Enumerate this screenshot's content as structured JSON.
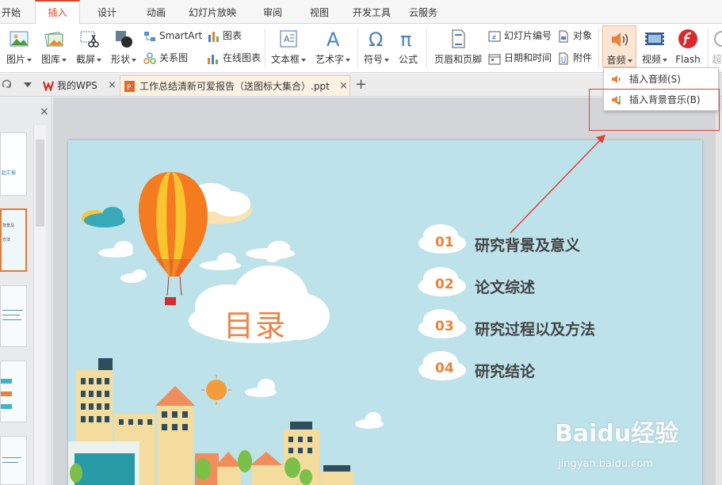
{
  "menu": {
    "tabs": [
      "开始",
      "插入",
      "设计",
      "动画",
      "幻灯片放映",
      "审阅",
      "视图",
      "开发工具",
      "云服务"
    ],
    "active": "插入"
  },
  "ribbon": {
    "picture": "图片",
    "gallery": "图库",
    "screenshot": "截屏",
    "shape": "形状",
    "smartart": "SmartArt",
    "relation": "关系图",
    "chart": "图表",
    "online_chart": "在线图表",
    "textbox": "文本框",
    "wordart": "艺术字",
    "symbol": "符号",
    "formula": "公式",
    "header_footer": "页眉和页脚",
    "slide_number": "幻灯片编号",
    "datetime": "日期和时间",
    "object": "对象",
    "attachment": "附件",
    "audio": "音频",
    "video": "视频",
    "flash": "Flash",
    "cut_off": "超"
  },
  "audio_menu": {
    "insert_audio": "插入音频(S)",
    "insert_bg_music": "插入背景音乐(B)"
  },
  "doc_tabs": {
    "my_wps": "我的WPS",
    "document": "工作总结清新可爱报告（送图标大集合）.ppt"
  },
  "slide": {
    "title": "目录",
    "items": [
      {
        "num": "01",
        "label": "研究背景及意义"
      },
      {
        "num": "02",
        "label": "论文综述"
      },
      {
        "num": "03",
        "label": "研究过程以及方法"
      },
      {
        "num": "04",
        "label": "研究结论"
      }
    ]
  },
  "thumbnails": {
    "t1_text": "起汇报",
    "t2_text_a": "背景及",
    "t2_text_b": "方法"
  },
  "watermark": {
    "brand": "Baidu经验",
    "sub": "jingyan.baidu.com"
  },
  "colors": {
    "accent": "#d24726",
    "slide_bg": "#bde2ea",
    "toc_number": "#e8833a",
    "highlight": "#e0403a"
  }
}
